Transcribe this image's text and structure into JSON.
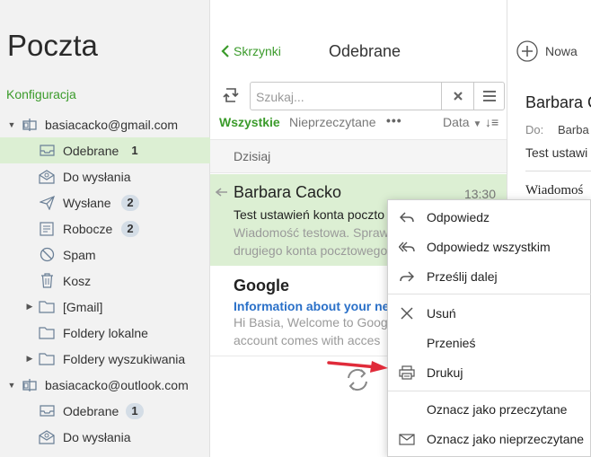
{
  "app": {
    "title": "Poczta",
    "config_link": "Konfiguracja"
  },
  "colors": {
    "accent": "#3b9b2b",
    "selected_bg": "#dcefd3",
    "link_blue": "#2a70c8",
    "arrow_red": "#e02b3a"
  },
  "sidebar": {
    "accounts": [
      {
        "name": "basiacacko@gmail.com",
        "icon": "account-icon"
      },
      {
        "name": "basiacacko@outlook.com",
        "icon": "account-icon"
      }
    ],
    "items": [
      {
        "label": "Odebrane",
        "icon": "inbox-icon",
        "count": "1"
      },
      {
        "label": "Do wysłania",
        "icon": "outbox-icon"
      },
      {
        "label": "Wysłane",
        "icon": "sent-icon",
        "count": "2"
      },
      {
        "label": "Robocze",
        "icon": "drafts-icon",
        "count": "2"
      },
      {
        "label": "Spam",
        "icon": "spam-icon"
      },
      {
        "label": "Kosz",
        "icon": "trash-icon"
      },
      {
        "label": "[Gmail]",
        "icon": "folder-icon"
      },
      {
        "label": "Foldery lokalne",
        "icon": "folder-icon"
      },
      {
        "label": "Foldery wyszukiwania",
        "icon": "folder-icon"
      },
      {
        "label": "Odebrane",
        "icon": "inbox-icon",
        "count": "1"
      },
      {
        "label": "Do wysłania",
        "icon": "outbox-icon"
      }
    ]
  },
  "header": {
    "back_label": "Skrzynki",
    "title": "Odebrane",
    "new_label": "Nowa"
  },
  "search": {
    "placeholder": "Szukaj..."
  },
  "filters": {
    "all": "Wszystkie",
    "unread": "Nieprzeczytane",
    "more": "•••",
    "sort": "Data",
    "sort_dir": "↓≡"
  },
  "list": {
    "group": "Dzisiaj",
    "messages": [
      {
        "sender": "Barbara Cacko",
        "time": "13:30",
        "subject": "Test ustawień konta poczto",
        "preview_line1": "Wiadomość testowa. Spraw",
        "preview_line2": "drugiego konta pocztowego"
      },
      {
        "sender": "Google",
        "subject": "Information about your new",
        "preview_line1": "Hi Basia, Welcome to Goog",
        "preview_line2": "account comes with acces"
      }
    ]
  },
  "reader": {
    "sender": "Barbara C",
    "to_label": "Do:",
    "to": "Barba",
    "subject": "Test ustawi",
    "body": "Wiadomoś"
  },
  "context_menu": {
    "items": [
      {
        "label": "Odpowiedz",
        "icon": "reply-icon"
      },
      {
        "label": "Odpowiedz wszystkim",
        "icon": "reply-all-icon"
      },
      {
        "label": "Prześlij dalej",
        "icon": "forward-icon"
      },
      {
        "label": "Usuń",
        "icon": "delete-icon"
      },
      {
        "label": "Przenieś",
        "icon": ""
      },
      {
        "label": "Drukuj",
        "icon": "print-icon"
      },
      {
        "label": "Oznacz jako przeczytane",
        "icon": ""
      },
      {
        "label": "Oznacz jako nieprzeczytane",
        "icon": "mail-icon"
      }
    ]
  }
}
